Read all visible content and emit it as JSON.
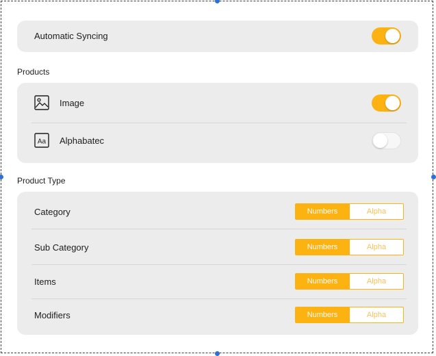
{
  "sync": {
    "label": "Automatic Syncing",
    "enabled": true
  },
  "products": {
    "title": "Products",
    "items": [
      {
        "label": "Image",
        "icon": "image-icon",
        "enabled": true
      },
      {
        "label": "Alphabatec",
        "icon": "text-format-icon",
        "icon_text": "Aa",
        "enabled": false
      }
    ]
  },
  "product_type": {
    "title": "Product Type",
    "options": [
      "Numbers",
      "Alpha"
    ],
    "rows": [
      {
        "label": "Category",
        "selected": "Numbers"
      },
      {
        "label": "Sub Category",
        "selected": "Numbers"
      },
      {
        "label": "Items",
        "selected": "Numbers"
      },
      {
        "label": "Modifiers",
        "selected": "Numbers"
      }
    ]
  },
  "colors": {
    "accent": "#fcb210",
    "card": "#ececec",
    "selection_handle": "#2f6fd6"
  }
}
